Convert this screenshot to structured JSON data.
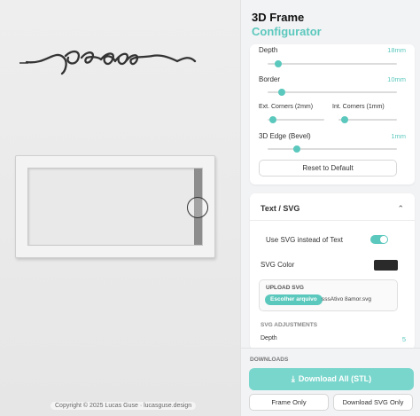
{
  "preview": {
    "copyright": "Copyright © 2025 Lucas Guse · lucasguse.design",
    "word": "peace"
  },
  "header": {
    "title_line1": "3D Frame",
    "title_line2": "Configurator"
  },
  "frame_settings": {
    "depth": {
      "label": "Depth",
      "value": "18mm",
      "level": 0.08
    },
    "border": {
      "label": "Border",
      "value": "10mm",
      "level": 0.1
    },
    "ext_corners": {
      "label": "Ext. Corners (2mm)",
      "level": 0.1
    },
    "int_corners": {
      "label": "Int. Corners (1mm)",
      "level": 0.1
    },
    "edge_bevel": {
      "label": "3D Edge (Bevel)",
      "value": "1mm",
      "level": 0.2
    },
    "reset_label": "Reset to Default"
  },
  "text_svg": {
    "section_title": "Text / SVG",
    "use_svg_label": "Use SVG instead of Text",
    "use_svg_enabled": true,
    "svg_color_label": "SVG Color",
    "svg_color": "#2a2a2a",
    "upload_label": "UPLOAD SVG",
    "choose_file_label": "Escolher arquivo",
    "file_name": "sssAtivo 8amor.svg",
    "adjustments_label": "SVG ADJUSTMENTS",
    "depth_label": "Depth",
    "depth_value": "5"
  },
  "downloads": {
    "label": "DOWNLOADS",
    "download_all": "Download All (STL)",
    "frame_only": "Frame Only",
    "svg_only": "Download SVG Only"
  },
  "colors": {
    "accent": "#5bc8bd",
    "accent_light": "#79d6cc"
  }
}
